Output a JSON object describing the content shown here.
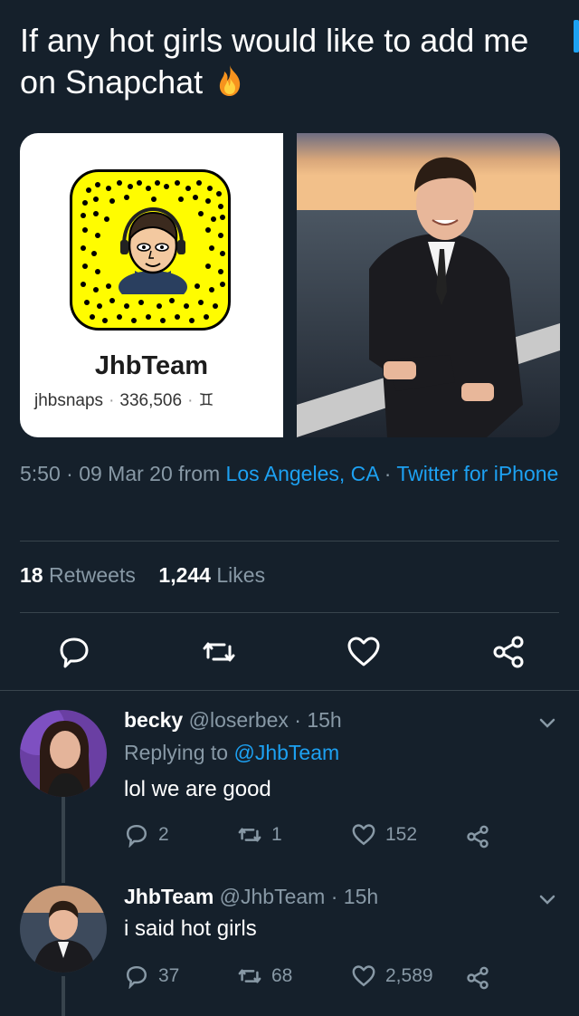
{
  "tweet": {
    "text": "If any hot girls would like to add me on Snapchat",
    "emoji_icon": "fire-emoji"
  },
  "snapcard": {
    "display_name": "JhbTeam",
    "username": "jhbsnaps",
    "score": "336,506",
    "zodiac": "♊"
  },
  "meta": {
    "time": "5:50 · 09 Mar 20 from ",
    "location": "Los Angeles, CA",
    "sep": " · ",
    "client": "Twitter for iPhone"
  },
  "stats": {
    "retweets_count": "18",
    "retweets_label": "Retweets",
    "likes_count": "1,244",
    "likes_label": "Likes"
  },
  "replies": [
    {
      "name": "becky",
      "handle": "@loserbex · 15h",
      "replying_prefix": "Replying to ",
      "replying_to": "@JhbTeam",
      "text": "lol we are good",
      "replies": "2",
      "retweets": "1",
      "likes": "152"
    },
    {
      "name": "JhbTeam",
      "handle": "@JhbTeam · 15h",
      "text": "i said hot girls",
      "replies": "37",
      "retweets": "68",
      "likes": "2,589"
    }
  ],
  "colors": {
    "background": "#15202b",
    "accent": "#1da1f2",
    "muted": "#8899a6",
    "divider": "#38444d",
    "snap_yellow": "#fffc00"
  }
}
